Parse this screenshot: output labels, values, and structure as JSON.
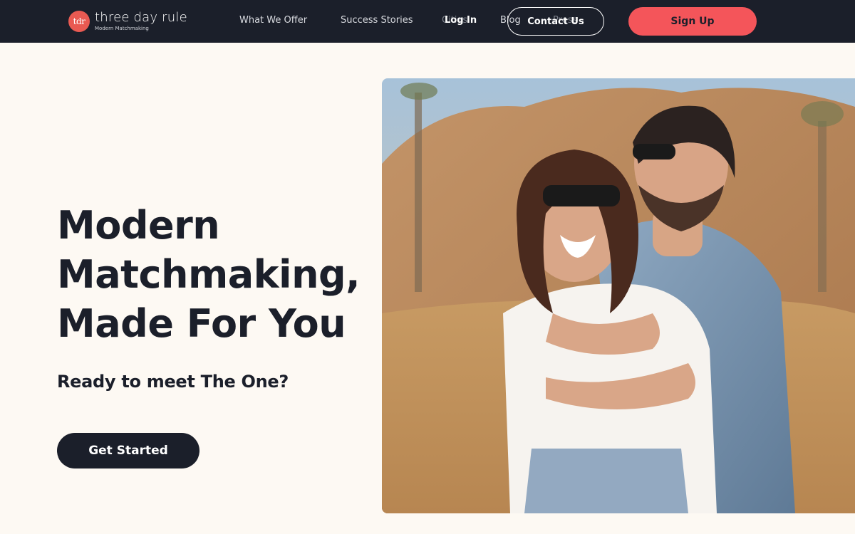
{
  "header": {
    "logo_mark": "tdr",
    "logo_name": "three day rule",
    "logo_tagline": "Modern Matchmaking",
    "nav": [
      {
        "label": "What We Offer"
      },
      {
        "label": "Success Stories"
      },
      {
        "label": "Cities"
      },
      {
        "label": "Blog"
      },
      {
        "label": "Press"
      }
    ],
    "login_label": "Log In",
    "contact_label": "Contact Us",
    "signup_label": "Sign Up"
  },
  "hero": {
    "title_lines": [
      "Modern",
      "Matchmaking,",
      "Made For You"
    ],
    "subtitle": "Ready to meet The One?",
    "cta_label": "Get Started",
    "image_icon": "couple-photo"
  },
  "colors": {
    "nav_bg": "#1b1f2a",
    "page_bg": "#fdf9f3",
    "accent": "#f4555a",
    "text_dark": "#1b1f2a"
  }
}
